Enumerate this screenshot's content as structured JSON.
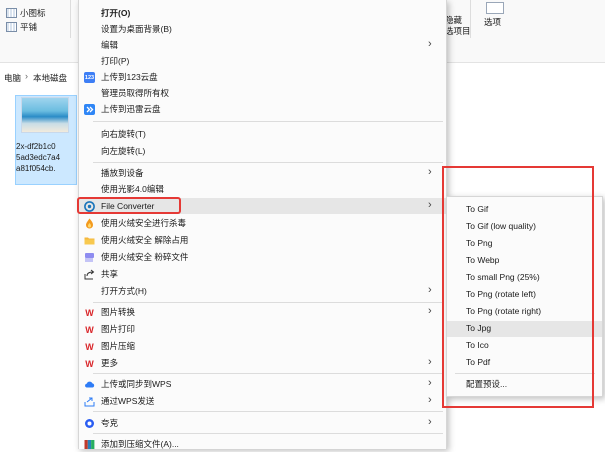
{
  "ribbon": {
    "small_icons": "小图标",
    "tile": "平铺",
    "hide_selected": "隐藏",
    "selected_items": "选项目",
    "options": "选项"
  },
  "address": {
    "this_pc": "电脑",
    "separator": "›",
    "drive": "本地磁盘"
  },
  "file": {
    "name_line1": "2x-df2b1c0",
    "name_line2": "5ad3edc7a4",
    "name_line3": "a81f054cb."
  },
  "menu": {
    "items": [
      {
        "label": "打开(O)",
        "icon": "",
        "arrow": ""
      },
      {
        "label": "设置为桌面背景(B)",
        "icon": "",
        "arrow": ""
      },
      {
        "label": "编辑",
        "icon": "",
        "arrow": "›"
      },
      {
        "label": "打印(P)",
        "icon": "",
        "arrow": ""
      },
      {
        "label": "上传到123云盘",
        "icon": "123",
        "arrow": ""
      },
      {
        "label": "管理员取得所有权",
        "icon": "",
        "arrow": ""
      },
      {
        "label": "上传到迅雷云盘",
        "icon": "",
        "arrow": ""
      },
      {
        "label": "向右旋转(T)",
        "icon": "",
        "arrow": ""
      },
      {
        "label": "向左旋转(L)",
        "icon": "",
        "arrow": ""
      },
      {
        "label": "播放到设备",
        "icon": "",
        "arrow": "›"
      },
      {
        "label": "使用光影4.0编辑",
        "icon": "",
        "arrow": ""
      },
      {
        "label": "File Converter",
        "icon": "",
        "arrow": "›"
      },
      {
        "label": "使用火绒安全进行杀毒",
        "icon": "",
        "arrow": ""
      },
      {
        "label": "使用火绒安全 解除占用",
        "icon": "",
        "arrow": ""
      },
      {
        "label": "使用火绒安全 粉碎文件",
        "icon": "",
        "arrow": ""
      },
      {
        "label": "共享",
        "icon": "",
        "arrow": ""
      },
      {
        "label": "打开方式(H)",
        "icon": "",
        "arrow": "›"
      },
      {
        "label": "图片转换",
        "icon": "",
        "arrow": "›"
      },
      {
        "label": "图片打印",
        "icon": "",
        "arrow": ""
      },
      {
        "label": "图片压缩",
        "icon": "",
        "arrow": ""
      },
      {
        "label": "更多",
        "icon": "",
        "arrow": "›"
      },
      {
        "label": "上传或同步到WPS",
        "icon": "",
        "arrow": "›"
      },
      {
        "label": "通过WPS发送",
        "icon": "",
        "arrow": "›"
      },
      {
        "label": "夸克",
        "icon": "",
        "arrow": "›"
      },
      {
        "label": "添加到压缩文件(A)...",
        "icon": "",
        "arrow": ""
      }
    ]
  },
  "submenu": {
    "items": [
      "To Gif",
      "To Gif (low quality)",
      "To Png",
      "To Webp",
      "To small Png (25%)",
      "To Png (rotate left)",
      "To Png (rotate right)",
      "To Jpg",
      "To Ico",
      "To Pdf",
      "配置预设..."
    ]
  },
  "colors": {
    "highlight_box": "#e53935",
    "hover": "#e6e6e6",
    "wps_red": "#d9262a",
    "baidu_blue": "#2e7cf6"
  }
}
